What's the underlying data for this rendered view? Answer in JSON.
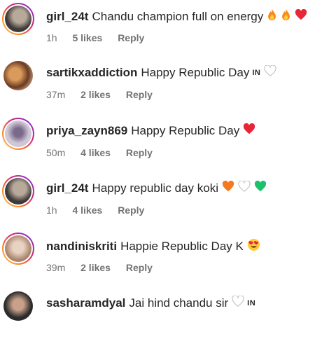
{
  "comments": [
    {
      "username": "girl_24t",
      "text": "Chandu champion full on energy",
      "time": "1h",
      "likes": "5 likes",
      "reply": "Reply",
      "avatar_colors": [
        "#3d3a3a",
        "#b8a99a"
      ],
      "emojis": [
        "fire-emoji",
        "fire-emoji",
        "red-heart-emoji"
      ]
    },
    {
      "username": "sartikxaddiction",
      "text": "Happy Republic Day",
      "flag": "IN",
      "time": "37m",
      "likes": "2 likes",
      "reply": "Reply",
      "avatar_colors": [
        "#6b3a22",
        "#d99a5c"
      ],
      "emojis": [
        "white-heart-emoji"
      ]
    },
    {
      "username": "priya_zayn869",
      "text": "Happy Republic Day",
      "time": "50m",
      "likes": "4 likes",
      "reply": "Reply",
      "avatar_colors": [
        "#cfc6d6",
        "#7a6a8a"
      ],
      "emojis": [
        "red-heart-emoji"
      ]
    },
    {
      "username": "girl_24t",
      "text": "Happy republic day koki",
      "time": "1h",
      "likes": "4 likes",
      "reply": "Reply",
      "avatar_colors": [
        "#3d3a3a",
        "#b8a99a"
      ],
      "emojis": [
        "orange-heart-emoji",
        "white-heart-emoji",
        "green-heart-emoji"
      ]
    },
    {
      "username": "nandiniskriti",
      "text": "Happie Republic Day K",
      "time": "39m",
      "likes": "2 likes",
      "reply": "Reply",
      "avatar_colors": [
        "#a9836b",
        "#e8d2c2"
      ],
      "emojis": [
        "heart-eyes-emoji"
      ]
    },
    {
      "username": "sasharamdyal",
      "text": "Jai hind chandu sir",
      "flag": "IN",
      "avatar_colors": [
        "#2b2b2b",
        "#c9a08a"
      ],
      "emojis": [
        "white-heart-emoji"
      ]
    }
  ]
}
